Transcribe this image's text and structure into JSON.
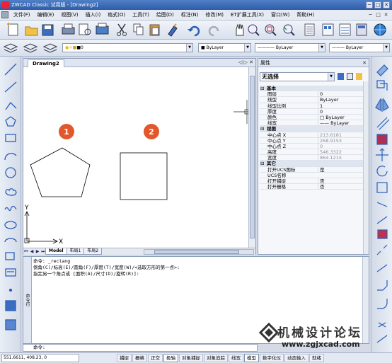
{
  "window": {
    "title": "ZWCAD Classic 试用版 - [Drawing2]",
    "min": "─",
    "max": "□",
    "close": "✕"
  },
  "menu": [
    "文件(F)",
    "编辑(E)",
    "视图(V)",
    "插入(I)",
    "格式(O)",
    "工具(T)",
    "绘图(D)",
    "标注(N)",
    "修改(M)",
    "ET扩展工具(X)",
    "窗口(W)",
    "帮助(H)"
  ],
  "layers": {
    "current": "0",
    "color": "ByLayer",
    "linetype": "ByLayer",
    "lineweight": "ByLayer"
  },
  "drawing": {
    "tab": "Drawing2",
    "tab_controls": "◁ ▷ ✕",
    "markers": [
      {
        "label": "1",
        "color": "#e2572c"
      },
      {
        "label": "2",
        "color": "#e2572c"
      }
    ],
    "axis_x": "X",
    "axis_y": "Y",
    "layout_tabs": [
      "Model",
      "布局1",
      "布局2"
    ]
  },
  "properties": {
    "title": "属性",
    "close": "✕",
    "selection": "无选择",
    "sections": [
      {
        "name": "基本",
        "rows": [
          [
            "图层",
            "0",
            false
          ],
          [
            "线型",
            "ByLayer",
            false
          ],
          [
            "线型比例",
            "1",
            false
          ],
          [
            "厚度",
            "0",
            false
          ],
          [
            "颜色",
            "□ ByLayer",
            false
          ],
          [
            "线宽",
            "—— ByLayer",
            false
          ]
        ]
      },
      {
        "name": "视图",
        "rows": [
          [
            "中心点 X",
            "213.6181",
            true
          ],
          [
            "中心点 Y",
            "268.9153",
            true
          ],
          [
            "中心点 Z",
            "0",
            true
          ],
          [
            "高度",
            "546.3322",
            true
          ],
          [
            "宽度",
            "864.1215",
            true
          ]
        ]
      },
      {
        "name": "其它",
        "rows": [
          [
            "打开UCS图标",
            "是",
            false
          ],
          [
            "UCS名称",
            "",
            false
          ],
          [
            "打开捕捉",
            "否",
            false
          ],
          [
            "打开栅格",
            "否",
            false
          ]
        ]
      }
    ]
  },
  "command": {
    "side_label": "命令行",
    "lines": [
      "命令: _rectang",
      "倒角(C)/标高(E)/圆角(F)/厚度(T)/宽度(W)/<选取方形的第一点>:",
      "指定另一个角点或 [面积(A)/尺寸(D)/旋转(R)]:"
    ],
    "prompt": "命令:"
  },
  "watermark": {
    "text": "机械设计论坛",
    "url": "www.zgjxcad.com"
  },
  "status": {
    "coords": "551.6611, 408.23, 0",
    "buttons": [
      [
        "捕捉",
        false
      ],
      [
        "栅格",
        false
      ],
      [
        "正交",
        false
      ],
      [
        "极轴",
        true
      ],
      [
        "对象捕捉",
        false
      ],
      [
        "对象追踪",
        false
      ],
      [
        "线宽",
        false
      ],
      [
        "模型",
        true
      ],
      [
        "数字化仪",
        false
      ],
      [
        "动态输入",
        false
      ],
      [
        "就绪",
        false
      ]
    ]
  },
  "colors": {
    "accent": "#2f5da8",
    "marker": "#e2572c"
  }
}
